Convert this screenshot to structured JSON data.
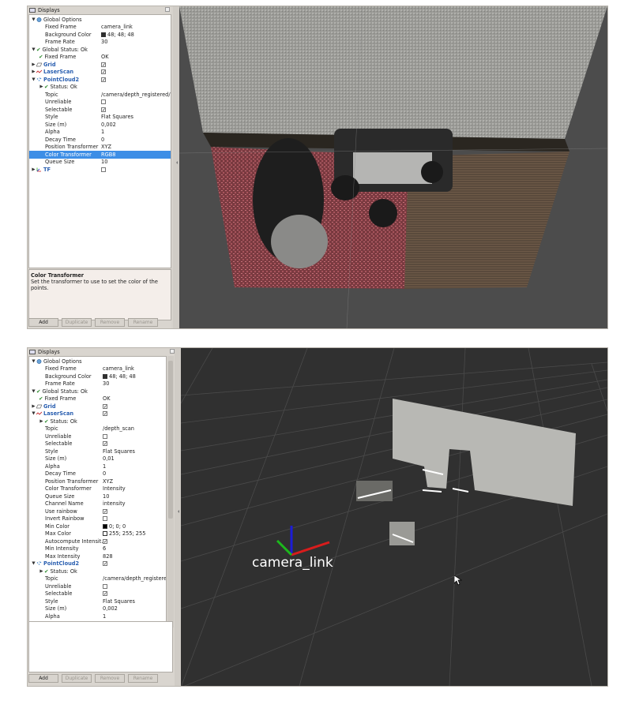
{
  "top_window": {
    "panel_title": "Displays",
    "rows": [
      {
        "label": "Global Options",
        "value": "",
        "kind": "section",
        "icon": "globe-icon"
      },
      {
        "label": "Fixed Frame",
        "value": "camera_link",
        "kind": "prop"
      },
      {
        "label": "Background Color",
        "value": "48; 48; 48",
        "kind": "color",
        "color": "#303030"
      },
      {
        "label": "Frame Rate",
        "value": "30",
        "kind": "prop"
      },
      {
        "label": "Global Status: Ok",
        "value": "",
        "kind": "status-section"
      },
      {
        "label": "Fixed Frame",
        "value": "OK",
        "kind": "status"
      },
      {
        "label": "Grid",
        "value": "",
        "kind": "display",
        "icon": "grid-icon",
        "checked": true
      },
      {
        "label": "LaserScan",
        "value": "",
        "kind": "display",
        "icon": "laserscan-icon",
        "checked": true
      },
      {
        "label": "PointCloud2",
        "value": "",
        "kind": "display-open",
        "icon": "pointcloud-icon",
        "checked": true
      },
      {
        "label": "Status: Ok",
        "value": "",
        "kind": "status-sub"
      },
      {
        "label": "Topic",
        "value": "/camera/depth_registered/p...",
        "kind": "prop2"
      },
      {
        "label": "Unreliable",
        "value": "",
        "kind": "check2",
        "checked": false
      },
      {
        "label": "Selectable",
        "value": "",
        "kind": "check2",
        "checked": true
      },
      {
        "label": "Style",
        "value": "Flat Squares",
        "kind": "prop2"
      },
      {
        "label": "Size (m)",
        "value": "0,002",
        "kind": "prop2"
      },
      {
        "label": "Alpha",
        "value": "1",
        "kind": "prop2"
      },
      {
        "label": "Decay Time",
        "value": "0",
        "kind": "prop2"
      },
      {
        "label": "Position Transformer",
        "value": "XYZ",
        "kind": "prop2"
      },
      {
        "label": "Color Transformer",
        "value": "RGB8",
        "kind": "prop2",
        "selected": true
      },
      {
        "label": "Queue Size",
        "value": "10",
        "kind": "prop2"
      },
      {
        "label": "TF",
        "value": "",
        "kind": "display",
        "icon": "tf-icon",
        "checked": false
      }
    ],
    "description_title": "Color Transformer",
    "description_text": "Set the transformer to use to set the color of the points.",
    "buttons": [
      "Add",
      "Duplicate",
      "Remove",
      "Rename"
    ]
  },
  "bottom_window": {
    "panel_title": "Displays",
    "rows": [
      {
        "label": "Global Options",
        "value": "",
        "kind": "section",
        "icon": "globe-icon"
      },
      {
        "label": "Fixed Frame",
        "value": "camera_link",
        "kind": "prop"
      },
      {
        "label": "Background Color",
        "value": "48; 48; 48",
        "kind": "color",
        "color": "#303030"
      },
      {
        "label": "Frame Rate",
        "value": "30",
        "kind": "prop"
      },
      {
        "label": "Global Status: Ok",
        "value": "",
        "kind": "status-section"
      },
      {
        "label": "Fixed Frame",
        "value": "OK",
        "kind": "status"
      },
      {
        "label": "Grid",
        "value": "",
        "kind": "display",
        "icon": "grid-icon",
        "checked": true
      },
      {
        "label": "LaserScan",
        "value": "",
        "kind": "display-open",
        "icon": "laserscan-icon",
        "checked": true
      },
      {
        "label": "Status: Ok",
        "value": "",
        "kind": "status-sub"
      },
      {
        "label": "Topic",
        "value": "/depth_scan",
        "kind": "prop2"
      },
      {
        "label": "Unreliable",
        "value": "",
        "kind": "check2",
        "checked": false
      },
      {
        "label": "Selectable",
        "value": "",
        "kind": "check2",
        "checked": true
      },
      {
        "label": "Style",
        "value": "Flat Squares",
        "kind": "prop2"
      },
      {
        "label": "Size (m)",
        "value": "0,01",
        "kind": "prop2"
      },
      {
        "label": "Alpha",
        "value": "1",
        "kind": "prop2"
      },
      {
        "label": "Decay Time",
        "value": "0",
        "kind": "prop2"
      },
      {
        "label": "Position Transformer",
        "value": "XYZ",
        "kind": "prop2"
      },
      {
        "label": "Color Transformer",
        "value": "Intensity",
        "kind": "prop2"
      },
      {
        "label": "Queue Size",
        "value": "10",
        "kind": "prop2"
      },
      {
        "label": "Channel Name",
        "value": "intensity",
        "kind": "prop2"
      },
      {
        "label": "Use rainbow",
        "value": "",
        "kind": "check2",
        "checked": true
      },
      {
        "label": "Invert Rainbow",
        "value": "",
        "kind": "check2",
        "checked": false
      },
      {
        "label": "Min Color",
        "value": "0; 0; 0",
        "kind": "color2",
        "color": "#000000"
      },
      {
        "label": "Max Color",
        "value": "255; 255; 255",
        "kind": "color2",
        "color": "#ffffff"
      },
      {
        "label": "Autocompute Intensit...",
        "value": "",
        "kind": "check2",
        "checked": true
      },
      {
        "label": "Min Intensity",
        "value": "6",
        "kind": "prop2"
      },
      {
        "label": "Max Intensity",
        "value": "828",
        "kind": "prop2"
      },
      {
        "label": "PointCloud2",
        "value": "",
        "kind": "display-open",
        "icon": "pointcloud-icon",
        "checked": true
      },
      {
        "label": "Status: Ok",
        "value": "",
        "kind": "status-sub"
      },
      {
        "label": "Topic",
        "value": "/camera/depth_registered/p...",
        "kind": "prop2"
      },
      {
        "label": "Unreliable",
        "value": "",
        "kind": "check2",
        "checked": false
      },
      {
        "label": "Selectable",
        "value": "",
        "kind": "check2",
        "checked": true
      },
      {
        "label": "Style",
        "value": "Flat Squares",
        "kind": "prop2"
      },
      {
        "label": "Size (m)",
        "value": "0,002",
        "kind": "prop2"
      },
      {
        "label": "Alpha",
        "value": "1",
        "kind": "prop2"
      }
    ],
    "buttons": [
      "Add",
      "Duplicate",
      "Remove",
      "Rename"
    ],
    "frame_label": "camera_link"
  },
  "colors": {
    "selection": "#3d8ee6",
    "display_name": "#2a5fb0",
    "status_ok": "#2a8a2a",
    "viewport_bg": "#303030"
  }
}
